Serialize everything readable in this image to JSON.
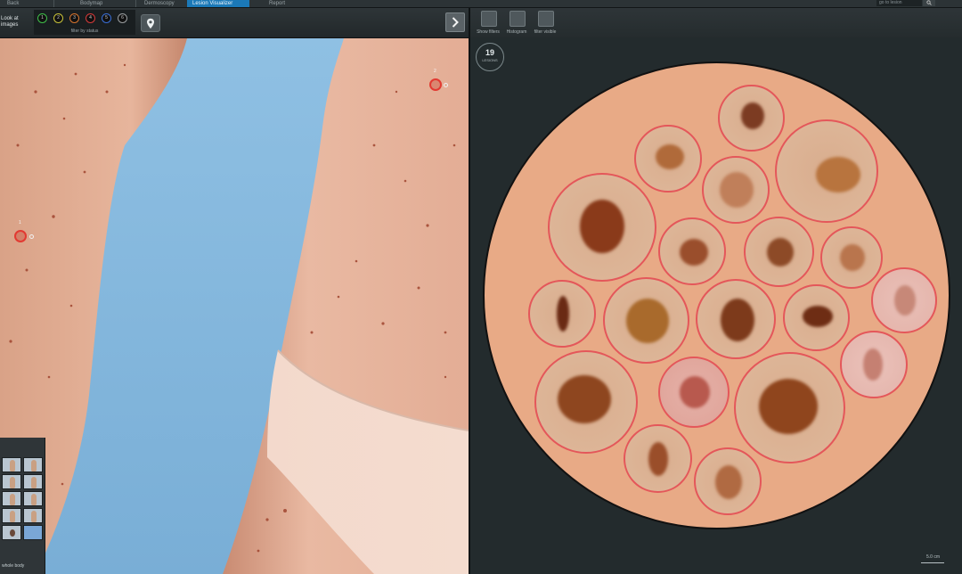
{
  "tabs": [
    {
      "label": "Back",
      "active": false
    },
    {
      "label": "Bodymap",
      "active": false
    },
    {
      "label": "Dermoscopy",
      "active": false
    },
    {
      "label": "Lesion Visualizer",
      "active": true
    },
    {
      "label": "Report",
      "active": false
    }
  ],
  "search": {
    "placeholder": "go to lesion"
  },
  "left_toolbar": {
    "look_label": "Look at images",
    "filter_label": "filter by status",
    "filters": [
      {
        "label": "1",
        "color": "#3fbf4a"
      },
      {
        "label": "2",
        "color": "#c8c23a"
      },
      {
        "label": "3",
        "color": "#d8752f"
      },
      {
        "label": "4",
        "color": "#d63a3a"
      },
      {
        "label": "5",
        "color": "#3a6fd6"
      },
      {
        "label": "6",
        "color": "#9a9ea0"
      }
    ],
    "pin_icon": "map-pin-icon",
    "next_icon": "chevron-right-icon"
  },
  "body_markers": [
    {
      "label": "1"
    },
    {
      "label": "2"
    }
  ],
  "thumb_panel": {
    "whole_body_label": "whole body",
    "views": [
      "front-upper",
      "back-upper",
      "front-mid",
      "back-mid",
      "side-left",
      "side-right",
      "front-lower",
      "back-lower",
      "head",
      "overview"
    ]
  },
  "right_toolbar": {
    "tools": [
      {
        "label": "Show filters",
        "icon": "filter-icon"
      },
      {
        "label": "Histogram",
        "icon": "histogram-icon"
      },
      {
        "label": "filter visible",
        "icon": "visible-filter-icon"
      }
    ]
  },
  "lesion_summary": {
    "count": "19",
    "unit": "LESIONS"
  },
  "scale_label": "5.0 cm",
  "colors": {
    "accent": "#1b79b8",
    "lesion_ring": "#e4575a",
    "skin": "#e8aa86"
  }
}
